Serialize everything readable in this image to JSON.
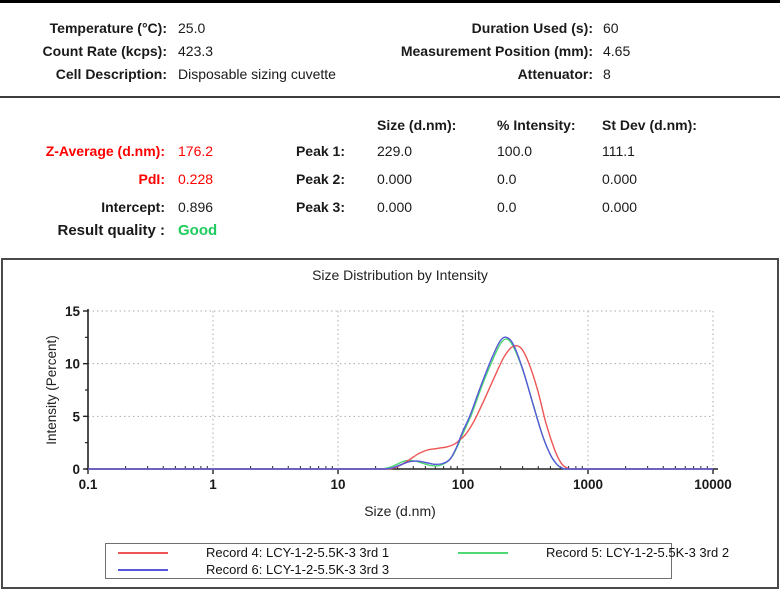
{
  "header": {
    "left": [
      {
        "label": "Temperature (°C):",
        "value": "25.0"
      },
      {
        "label": "Count Rate (kcps):",
        "value": "423.3"
      },
      {
        "label": "Cell Description:",
        "value": "Disposable sizing cuvette"
      }
    ],
    "right": [
      {
        "label": "Duration Used (s):",
        "value": "60"
      },
      {
        "label": "Measurement Position (mm):",
        "value": "4.65"
      },
      {
        "label": "Attenuator:",
        "value": "8"
      }
    ]
  },
  "results": {
    "rows": [
      {
        "label": "Z-Average (d.nm):",
        "value": "176.2"
      },
      {
        "label": "PdI:",
        "value": "0.228"
      },
      {
        "label": "Intercept:",
        "value": "0.896"
      },
      {
        "label": "Result quality :",
        "value": "Good"
      }
    ],
    "peak_table": {
      "headers": [
        "Size (d.nm):",
        "% Intensity:",
        "St Dev (d.nm):"
      ],
      "rows": [
        {
          "label": "Peak 1:",
          "size": "229.0",
          "intensity": "100.0",
          "stdev": "111.1"
        },
        {
          "label": "Peak 2:",
          "size": "0.000",
          "intensity": "0.0",
          "stdev": "0.000"
        },
        {
          "label": "Peak 3:",
          "size": "0.000",
          "intensity": "0.0",
          "stdev": "0.000"
        }
      ]
    }
  },
  "colors": {
    "accent_red": "#ff0000",
    "good_green": "#1ecb5c",
    "axis": "#222222",
    "grid": "#ababab"
  },
  "chart_data": {
    "type": "line",
    "title": "Size Distribution by Intensity",
    "xlabel": "Size (d.nm)",
    "ylabel": "Intensity (Percent)",
    "x_scale": "log",
    "xlim": [
      0.1,
      10000
    ],
    "ylim": [
      0,
      15
    ],
    "x_ticks": [
      0.1,
      1,
      10,
      100,
      1000,
      10000
    ],
    "x_tick_labels": [
      "0.1",
      "1",
      "10",
      "100",
      "1000",
      "10000"
    ],
    "y_ticks": [
      0,
      5,
      10,
      15
    ],
    "y_minor_ticks": [
      2.5,
      7.5,
      12.5
    ],
    "grid": true,
    "legend_position": "bottom",
    "series": [
      {
        "name": "Record 4: LCY-1-2-5.5K-3 3rd 1",
        "color": "#ee5555",
        "points": [
          [
            0.1,
            0
          ],
          [
            1,
            0
          ],
          [
            6,
            0
          ],
          [
            12,
            0
          ],
          [
            18,
            0
          ],
          [
            23,
            0
          ],
          [
            27,
            0.05
          ],
          [
            31,
            0.3
          ],
          [
            37,
            0.85
          ],
          [
            44,
            1.45
          ],
          [
            52,
            1.8
          ],
          [
            62,
            1.95
          ],
          [
            74,
            2.1
          ],
          [
            85,
            2.35
          ],
          [
            95,
            2.8
          ],
          [
            106,
            3.35
          ],
          [
            122,
            4.5
          ],
          [
            147,
            6.5
          ],
          [
            178,
            8.7
          ],
          [
            212,
            10.6
          ],
          [
            248,
            11.6
          ],
          [
            290,
            11.5
          ],
          [
            335,
            10.1
          ],
          [
            395,
            7.5
          ],
          [
            462,
            4.3
          ],
          [
            540,
            1.85
          ],
          [
            615,
            0.5
          ],
          [
            690,
            0.07
          ],
          [
            745,
            0
          ],
          [
            1200,
            0
          ],
          [
            4000,
            0
          ],
          [
            10000,
            0
          ]
        ]
      },
      {
        "name": "Record 5: LCY-1-2-5.5K-3 3rd 2",
        "color": "#4ed973",
        "points": [
          [
            0.1,
            0
          ],
          [
            1,
            0
          ],
          [
            6,
            0
          ],
          [
            12,
            0
          ],
          [
            17,
            0
          ],
          [
            21,
            0
          ],
          [
            25,
            0.1
          ],
          [
            29,
            0.4
          ],
          [
            34,
            0.75
          ],
          [
            39,
            0.8
          ],
          [
            46,
            0.6
          ],
          [
            54,
            0.35
          ],
          [
            63,
            0.3
          ],
          [
            73,
            0.6
          ],
          [
            83,
            1.3
          ],
          [
            93,
            2.5
          ],
          [
            102,
            3.6
          ],
          [
            118,
            5.3
          ],
          [
            142,
            7.9
          ],
          [
            172,
            10.3
          ],
          [
            202,
            12.0
          ],
          [
            228,
            12.3
          ],
          [
            258,
            11.4
          ],
          [
            305,
            9.2
          ],
          [
            365,
            6.1
          ],
          [
            435,
            3.1
          ],
          [
            505,
            1.25
          ],
          [
            575,
            0.33
          ],
          [
            635,
            0.05
          ],
          [
            685,
            0
          ],
          [
            1200,
            0
          ],
          [
            4000,
            0
          ],
          [
            10000,
            0
          ]
        ]
      },
      {
        "name": "Record 6: LCY-1-2-5.5K-3 3rd 3",
        "color": "#5757d9",
        "points": [
          [
            0.1,
            0
          ],
          [
            1,
            0
          ],
          [
            6,
            0
          ],
          [
            12,
            0
          ],
          [
            18,
            0
          ],
          [
            23,
            0
          ],
          [
            27,
            0.1
          ],
          [
            31,
            0.35
          ],
          [
            37,
            0.68
          ],
          [
            43,
            0.75
          ],
          [
            50,
            0.62
          ],
          [
            59,
            0.45
          ],
          [
            69,
            0.52
          ],
          [
            79,
            0.95
          ],
          [
            89,
            2.1
          ],
          [
            99,
            3.5
          ],
          [
            114,
            5.1
          ],
          [
            137,
            7.7
          ],
          [
            167,
            10.3
          ],
          [
            197,
            12.1
          ],
          [
            222,
            12.5
          ],
          [
            252,
            11.85
          ],
          [
            298,
            9.6
          ],
          [
            358,
            6.4
          ],
          [
            428,
            3.35
          ],
          [
            498,
            1.4
          ],
          [
            568,
            0.4
          ],
          [
            628,
            0.08
          ],
          [
            680,
            0
          ],
          [
            1200,
            0
          ],
          [
            4000,
            0
          ],
          [
            10000,
            0
          ]
        ]
      }
    ]
  }
}
